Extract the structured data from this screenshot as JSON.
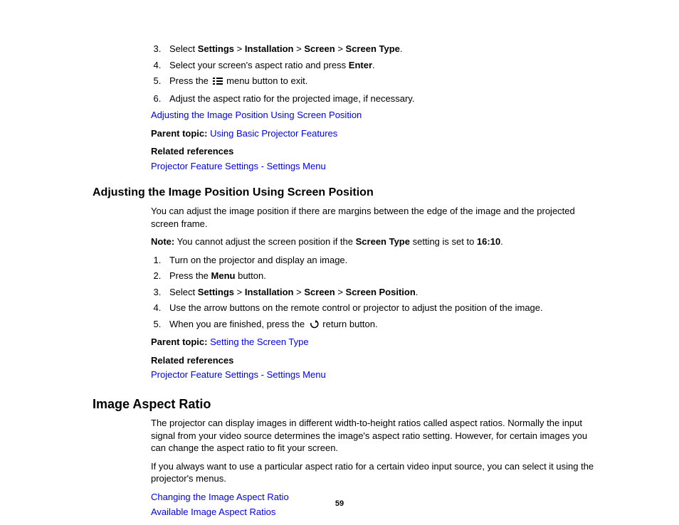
{
  "top_list": {
    "start": 3,
    "items": [
      {
        "pre": "Select ",
        "b1": "Settings",
        "sep": " > ",
        "b2": "Installation",
        "b3": "Screen",
        "b4": "Screen Type",
        "post": "."
      },
      {
        "pre": "Select your screen's aspect ratio and press ",
        "b1": "Enter",
        "post": "."
      },
      {
        "pre": "Press the ",
        "icon": "menu-icon",
        "post": " menu button to exit."
      },
      {
        "pre": "Adjust the aspect ratio for the projected image, if necessary."
      }
    ],
    "after_link": "Adjusting the Image Position Using Screen Position",
    "parent_topic_label": "Parent topic:",
    "parent_topic_link": "Using Basic Projector Features",
    "related_label": "Related references",
    "related_link": "Projector Feature Settings - Settings Menu"
  },
  "sectionA": {
    "heading": "Adjusting the Image Position Using Screen Position",
    "intro": "You can adjust the image position if there are margins between the edge of the image and the projected screen frame.",
    "note_label": "Note:",
    "note_pre": " You cannot adjust the screen position if the ",
    "note_b1": "Screen Type",
    "note_mid": " setting is set to ",
    "note_b2": "16:10",
    "note_post": ".",
    "list": {
      "start": 1,
      "items": [
        {
          "pre": "Turn on the projector and display an image."
        },
        {
          "pre": "Press the ",
          "b1": "Menu",
          "post": " button."
        },
        {
          "pre": "Select ",
          "b1": "Settings",
          "sep": " > ",
          "b2": "Installation",
          "b3": "Screen",
          "b4": "Screen Position",
          "post": "."
        },
        {
          "pre": "Use the arrow buttons on the remote control or projector to adjust the position of the image."
        },
        {
          "pre": "When you are finished, press the ",
          "icon": "return-icon",
          "post": " return button."
        }
      ]
    },
    "parent_topic_label": "Parent topic:",
    "parent_topic_link": "Setting the Screen Type",
    "related_label": "Related references",
    "related_link": "Projector Feature Settings - Settings Menu"
  },
  "sectionB": {
    "heading": "Image Aspect Ratio",
    "para1": "The projector can display images in different width-to-height ratios called aspect ratios. Normally the input signal from your video source determines the image's aspect ratio setting. However, for certain images you can change the aspect ratio to fit your screen.",
    "para2": "If you always want to use a particular aspect ratio for a certain video input source, you can select it using the projector's menus.",
    "link1": "Changing the Image Aspect Ratio",
    "link2": "Available Image Aspect Ratios"
  },
  "page_number": "59"
}
